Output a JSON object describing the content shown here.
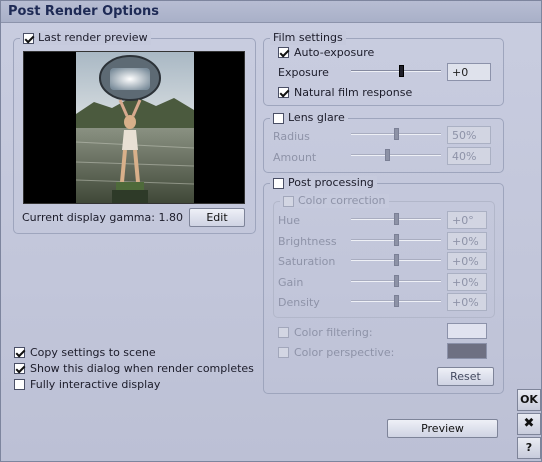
{
  "window": {
    "title": "Post Render Options"
  },
  "last_render": {
    "label": "Last render preview",
    "checked": true,
    "gamma_text": "Current display gamma: 1.80",
    "edit_label": "Edit"
  },
  "film": {
    "title": "Film settings",
    "auto_exposure_label": "Auto-exposure",
    "auto_exposure_checked": true,
    "exposure_label": "Exposure",
    "exposure_value": "+0",
    "exposure_level": 0.55,
    "natural_label": "Natural film response",
    "natural_checked": true
  },
  "lens_glare": {
    "label": "Lens glare",
    "checked": false,
    "radius_label": "Radius",
    "radius_value": "50%",
    "radius_level": 0.5,
    "amount_label": "Amount",
    "amount_value": "40%",
    "amount_level": 0.4
  },
  "post_processing": {
    "label": "Post processing",
    "checked": false,
    "color_correction_label": "Color correction",
    "color_correction_checked": false,
    "sliders": [
      {
        "label": "Hue",
        "value": "+0°",
        "level": 0.5
      },
      {
        "label": "Brightness",
        "value": "+0%",
        "level": 0.5
      },
      {
        "label": "Saturation",
        "value": "+0%",
        "level": 0.5
      },
      {
        "label": "Gain",
        "value": "+0%",
        "level": 0.5
      },
      {
        "label": "Density",
        "value": "+0%",
        "level": 0.5
      }
    ],
    "color_filtering_label": "Color filtering:",
    "color_filtering_color": "#e0e2ef",
    "color_perspective_label": "Color perspective:",
    "color_perspective_color": "#6e7082",
    "reset_label": "Reset"
  },
  "options": {
    "copy_label": "Copy settings to scene",
    "copy_checked": true,
    "show_label": "Show this dialog when render completes",
    "show_checked": true,
    "interactive_label": "Fully interactive display",
    "interactive_checked": false
  },
  "preview_button": "Preview",
  "side_buttons": {
    "ok": "OK",
    "cancel": "✖",
    "help": "?"
  }
}
